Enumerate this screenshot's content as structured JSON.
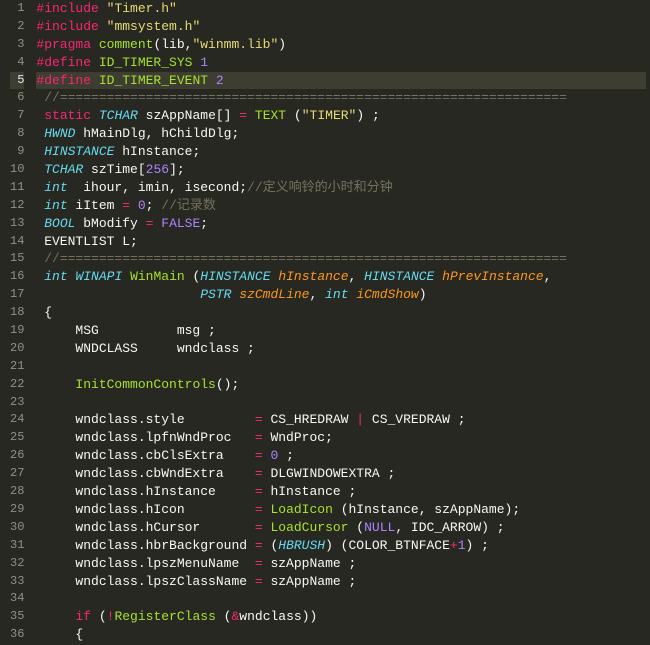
{
  "lines": [
    {
      "n": 1,
      "seg": [
        [
          "c-prep",
          "#include"
        ],
        [
          "c-plain",
          " "
        ],
        [
          "c-str",
          "\"Timer.h\""
        ]
      ]
    },
    {
      "n": 2,
      "seg": [
        [
          "c-prep",
          "#include"
        ],
        [
          "c-plain",
          " "
        ],
        [
          "c-str",
          "\"mmsystem.h\""
        ]
      ]
    },
    {
      "n": 3,
      "seg": [
        [
          "c-prep",
          "#pragma"
        ],
        [
          "c-plain",
          " "
        ],
        [
          "c-func",
          "comment"
        ],
        [
          "c-plain",
          "(lib,"
        ],
        [
          "c-str",
          "\"winmm.lib\""
        ],
        [
          "c-plain",
          ")"
        ]
      ]
    },
    {
      "n": 4,
      "seg": [
        [
          "c-prep",
          "#define"
        ],
        [
          "c-plain",
          " "
        ],
        [
          "c-func",
          "ID_TIMER_SYS"
        ],
        [
          "c-plain",
          " "
        ],
        [
          "c-num",
          "1"
        ]
      ]
    },
    {
      "n": 5,
      "hl": true,
      "seg": [
        [
          "c-prep",
          "#define"
        ],
        [
          "c-plain",
          " "
        ],
        [
          "c-func",
          "ID_TIMER_EVENT"
        ],
        [
          "c-plain",
          " "
        ],
        [
          "c-num",
          "2"
        ]
      ]
    },
    {
      "n": 6,
      "seg": [
        [
          "c-plain",
          " "
        ],
        [
          "c-comm",
          "//================================================================="
        ]
      ]
    },
    {
      "n": 7,
      "seg": [
        [
          "c-plain",
          " "
        ],
        [
          "c-keyr",
          "static"
        ],
        [
          "c-plain",
          " "
        ],
        [
          "c-type",
          "TCHAR"
        ],
        [
          "c-plain",
          " szAppName[] "
        ],
        [
          "c-op",
          "="
        ],
        [
          "c-plain",
          " "
        ],
        [
          "c-func",
          "TEXT"
        ],
        [
          "c-plain",
          " ("
        ],
        [
          "c-str",
          "\"TIMER\""
        ],
        [
          "c-plain",
          ") ;"
        ]
      ]
    },
    {
      "n": 8,
      "seg": [
        [
          "c-plain",
          " "
        ],
        [
          "c-type",
          "HWND"
        ],
        [
          "c-plain",
          " hMainDlg, hChildDlg;"
        ]
      ]
    },
    {
      "n": 9,
      "seg": [
        [
          "c-plain",
          " "
        ],
        [
          "c-type",
          "HINSTANCE"
        ],
        [
          "c-plain",
          " hInstance;"
        ]
      ]
    },
    {
      "n": 10,
      "seg": [
        [
          "c-plain",
          " "
        ],
        [
          "c-type",
          "TCHAR"
        ],
        [
          "c-plain",
          " szTime["
        ],
        [
          "c-num",
          "256"
        ],
        [
          "c-plain",
          "];"
        ]
      ]
    },
    {
      "n": 11,
      "seg": [
        [
          "c-plain",
          " "
        ],
        [
          "c-type",
          "int"
        ],
        [
          "c-plain",
          "  ihour, imin, isecond;"
        ],
        [
          "c-comm",
          "//定义响铃的小时和分钟"
        ]
      ]
    },
    {
      "n": 12,
      "seg": [
        [
          "c-plain",
          " "
        ],
        [
          "c-type",
          "int"
        ],
        [
          "c-plain",
          " iItem "
        ],
        [
          "c-op",
          "="
        ],
        [
          "c-plain",
          " "
        ],
        [
          "c-num",
          "0"
        ],
        [
          "c-plain",
          "; "
        ],
        [
          "c-comm",
          "//记录数"
        ]
      ]
    },
    {
      "n": 13,
      "seg": [
        [
          "c-plain",
          " "
        ],
        [
          "c-type",
          "BOOL"
        ],
        [
          "c-plain",
          " bModify "
        ],
        [
          "c-op",
          "="
        ],
        [
          "c-plain",
          " "
        ],
        [
          "c-const",
          "FALSE"
        ],
        [
          "c-plain",
          ";"
        ]
      ]
    },
    {
      "n": 14,
      "seg": [
        [
          "c-plain",
          " EVENTLIST L;"
        ]
      ]
    },
    {
      "n": 15,
      "seg": [
        [
          "c-plain",
          " "
        ],
        [
          "c-comm",
          "//================================================================="
        ]
      ]
    },
    {
      "n": 16,
      "seg": [
        [
          "c-plain",
          " "
        ],
        [
          "c-type",
          "int"
        ],
        [
          "c-plain",
          " "
        ],
        [
          "c-type",
          "WINAPI"
        ],
        [
          "c-plain",
          " "
        ],
        [
          "c-func",
          "WinMain"
        ],
        [
          "c-plain",
          " ("
        ],
        [
          "c-type",
          "HINSTANCE"
        ],
        [
          "c-plain",
          " "
        ],
        [
          "c-arg",
          "hInstance"
        ],
        [
          "c-plain",
          ", "
        ],
        [
          "c-type",
          "HINSTANCE"
        ],
        [
          "c-plain",
          " "
        ],
        [
          "c-arg",
          "hPrevInstance"
        ],
        [
          "c-plain",
          ","
        ]
      ]
    },
    {
      "n": 17,
      "seg": [
        [
          "c-plain",
          "                     "
        ],
        [
          "c-type",
          "PSTR"
        ],
        [
          "c-plain",
          " "
        ],
        [
          "c-arg",
          "szCmdLine"
        ],
        [
          "c-plain",
          ", "
        ],
        [
          "c-type",
          "int"
        ],
        [
          "c-plain",
          " "
        ],
        [
          "c-arg",
          "iCmdShow"
        ],
        [
          "c-plain",
          ")"
        ]
      ]
    },
    {
      "n": 18,
      "seg": [
        [
          "c-plain",
          " {"
        ]
      ]
    },
    {
      "n": 19,
      "seg": [
        [
          "c-plain",
          "     MSG          msg ;"
        ]
      ]
    },
    {
      "n": 20,
      "seg": [
        [
          "c-plain",
          "     WNDCLASS     wndclass ;"
        ]
      ]
    },
    {
      "n": 21,
      "seg": [
        [
          "c-plain",
          ""
        ]
      ]
    },
    {
      "n": 22,
      "seg": [
        [
          "c-plain",
          "     "
        ],
        [
          "c-func",
          "InitCommonControls"
        ],
        [
          "c-plain",
          "();"
        ]
      ]
    },
    {
      "n": 23,
      "seg": [
        [
          "c-plain",
          ""
        ]
      ]
    },
    {
      "n": 24,
      "seg": [
        [
          "c-plain",
          "     wndclass.style         "
        ],
        [
          "c-op",
          "="
        ],
        [
          "c-plain",
          " CS_HREDRAW "
        ],
        [
          "c-op",
          "|"
        ],
        [
          "c-plain",
          " CS_VREDRAW ;"
        ]
      ]
    },
    {
      "n": 25,
      "seg": [
        [
          "c-plain",
          "     wndclass.lpfnWndProc   "
        ],
        [
          "c-op",
          "="
        ],
        [
          "c-plain",
          " WndProc;"
        ]
      ]
    },
    {
      "n": 26,
      "seg": [
        [
          "c-plain",
          "     wndclass.cbClsExtra    "
        ],
        [
          "c-op",
          "="
        ],
        [
          "c-plain",
          " "
        ],
        [
          "c-num",
          "0"
        ],
        [
          "c-plain",
          " ;"
        ]
      ]
    },
    {
      "n": 27,
      "seg": [
        [
          "c-plain",
          "     wndclass.cbWndExtra    "
        ],
        [
          "c-op",
          "="
        ],
        [
          "c-plain",
          " DLGWINDOWEXTRA ;"
        ]
      ]
    },
    {
      "n": 28,
      "seg": [
        [
          "c-plain",
          "     wndclass.hInstance     "
        ],
        [
          "c-op",
          "="
        ],
        [
          "c-plain",
          " hInstance ;"
        ]
      ]
    },
    {
      "n": 29,
      "seg": [
        [
          "c-plain",
          "     wndclass.hIcon         "
        ],
        [
          "c-op",
          "="
        ],
        [
          "c-plain",
          " "
        ],
        [
          "c-func",
          "LoadIcon"
        ],
        [
          "c-plain",
          " (hInstance, szAppName);"
        ]
      ]
    },
    {
      "n": 30,
      "seg": [
        [
          "c-plain",
          "     wndclass.hCursor       "
        ],
        [
          "c-op",
          "="
        ],
        [
          "c-plain",
          " "
        ],
        [
          "c-func",
          "LoadCursor"
        ],
        [
          "c-plain",
          " ("
        ],
        [
          "c-const",
          "NULL"
        ],
        [
          "c-plain",
          ", IDC_ARROW) ;"
        ]
      ]
    },
    {
      "n": 31,
      "seg": [
        [
          "c-plain",
          "     wndclass.hbrBackground "
        ],
        [
          "c-op",
          "="
        ],
        [
          "c-plain",
          " ("
        ],
        [
          "c-type",
          "HBRUSH"
        ],
        [
          "c-plain",
          ") (COLOR_BTNFACE"
        ],
        [
          "c-op",
          "+"
        ],
        [
          "c-num",
          "1"
        ],
        [
          "c-plain",
          ") ;"
        ]
      ]
    },
    {
      "n": 32,
      "seg": [
        [
          "c-plain",
          "     wndclass.lpszMenuName  "
        ],
        [
          "c-op",
          "="
        ],
        [
          "c-plain",
          " szAppName ;"
        ]
      ]
    },
    {
      "n": 33,
      "seg": [
        [
          "c-plain",
          "     wndclass.lpszClassName "
        ],
        [
          "c-op",
          "="
        ],
        [
          "c-plain",
          " szAppName ;"
        ]
      ]
    },
    {
      "n": 34,
      "seg": [
        [
          "c-plain",
          ""
        ]
      ]
    },
    {
      "n": 35,
      "seg": [
        [
          "c-plain",
          "     "
        ],
        [
          "c-keyr",
          "if"
        ],
        [
          "c-plain",
          " ("
        ],
        [
          "c-op",
          "!"
        ],
        [
          "c-func",
          "RegisterClass"
        ],
        [
          "c-plain",
          " ("
        ],
        [
          "c-op",
          "&"
        ],
        [
          "c-plain",
          "wndclass))"
        ]
      ]
    },
    {
      "n": 36,
      "seg": [
        [
          "c-plain",
          "     {"
        ]
      ]
    }
  ]
}
